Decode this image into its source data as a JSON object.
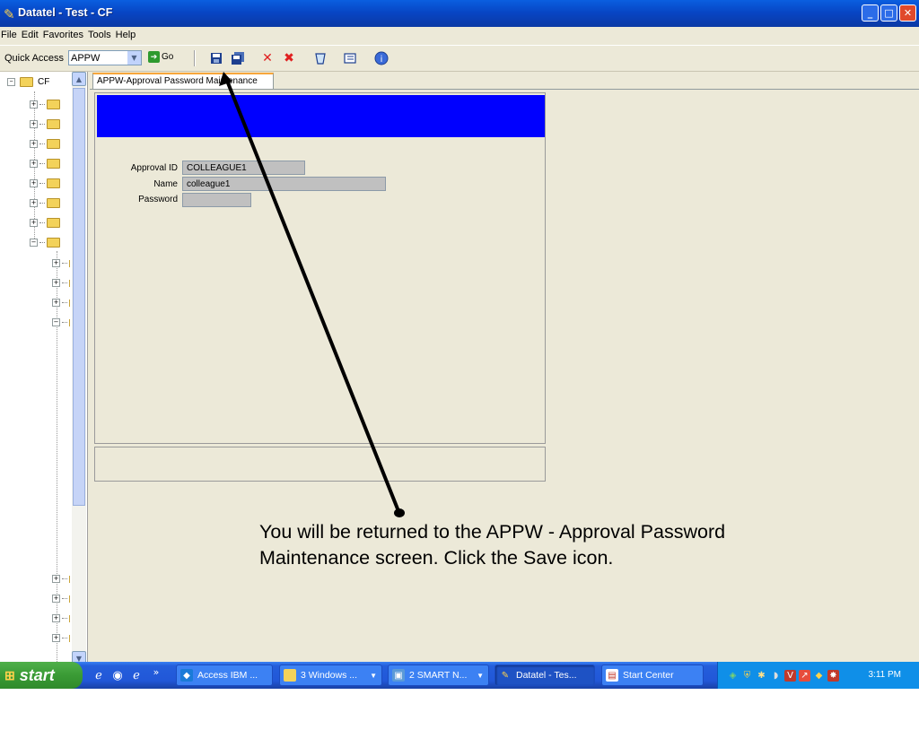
{
  "window": {
    "title": "Datatel - Test - CF",
    "app_icon": "datatel-icon",
    "controls": {
      "minimize": "minimize-icon",
      "maximize": "maximize-icon",
      "close": "close-icon"
    }
  },
  "menu": [
    "File",
    "Edit",
    "Favorites",
    "Tools",
    "Help"
  ],
  "toolbar": {
    "quick_access_label": "Quick Access",
    "quick_access_value": "APPW",
    "go_label": "Go",
    "icons": [
      "save-icon",
      "save-all-icon",
      "delete-icon",
      "delete-all-icon",
      "cancel-icon",
      "list-icon",
      "help-icon"
    ]
  },
  "tree": {
    "root_label": "CF"
  },
  "form": {
    "tab_label": "APPW-Approval Password Maintenance",
    "header_color": "#0000ff",
    "fields": [
      {
        "label": "Approval ID",
        "value": "COLLEAGUE1"
      },
      {
        "label": "Name",
        "value": "colleague1"
      },
      {
        "label": "Password",
        "value": ""
      }
    ]
  },
  "annotation": {
    "line1": "You will be returned to the APPW - Approval Password",
    "line2": "Maintenance screen.   Click the Save icon."
  },
  "taskbar": {
    "start_label": "start",
    "tasks": [
      {
        "label": "Access IBM ...",
        "icon": "ibm-access-icon"
      },
      {
        "label": "3 Windows ...",
        "icon": "folder-icon"
      },
      {
        "label": "2 SMART N...",
        "icon": "smart-notebook-icon"
      },
      {
        "label": "Datatel - Tes...",
        "icon": "datatel-icon"
      },
      {
        "label": "Start Center",
        "icon": "start-center-icon"
      }
    ],
    "clock": "3:11 PM"
  }
}
